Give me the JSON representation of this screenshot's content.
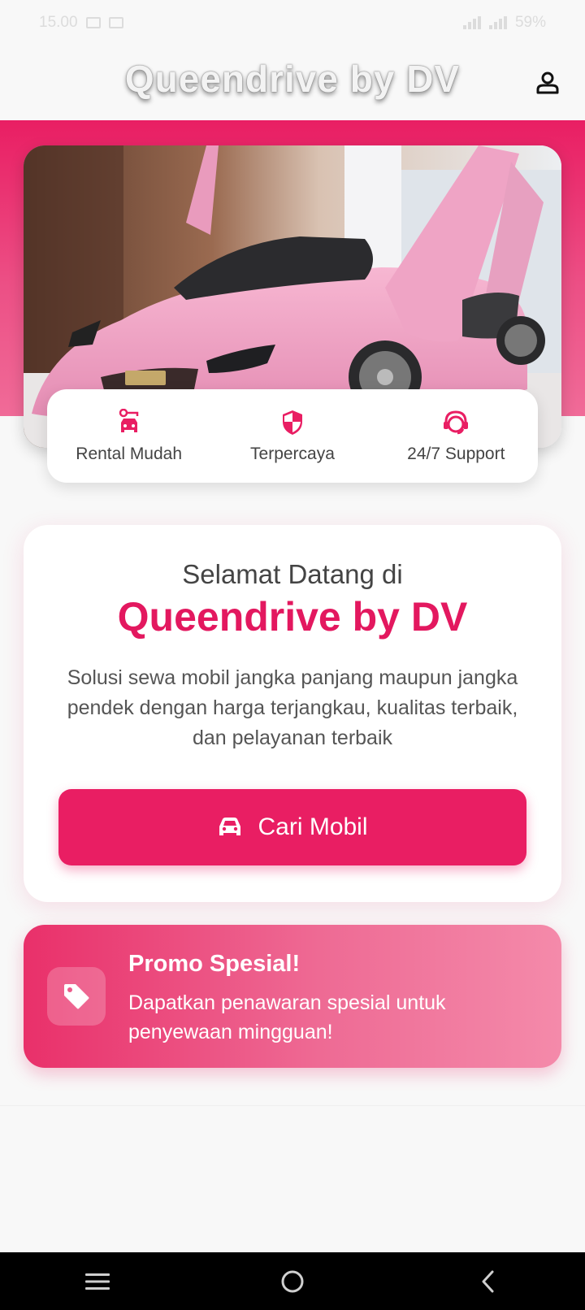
{
  "status_bar": {
    "time": "15.00",
    "battery": "59%"
  },
  "app": {
    "title": "Queendrive by DV"
  },
  "features": [
    {
      "label": "Rental Mudah",
      "icon": "car-key-icon"
    },
    {
      "label": "Terpercaya",
      "icon": "shield-icon"
    },
    {
      "label": "24/7 Support",
      "icon": "headset-icon"
    }
  ],
  "welcome": {
    "pre": "Selamat Datang di",
    "brand": "Queendrive by DV",
    "description": "Solusi sewa mobil jangka panjang maupun jangka pendek dengan harga terjangkau, kualitas terbaik, dan pelayanan terbaik",
    "cta_label": "Cari Mobil"
  },
  "promo": {
    "title": "Promo Spesial!",
    "text": "Dapatkan penawaran spesial untuk penyewaan mingguan!",
    "icon": "tag-icon"
  },
  "nav": {
    "items": [
      "menu-icon",
      "home-icon",
      "back-icon"
    ]
  },
  "colors": {
    "primary": "#e91e63",
    "brand_text": "#e3185f",
    "car_pink": "#f2a2c6"
  }
}
